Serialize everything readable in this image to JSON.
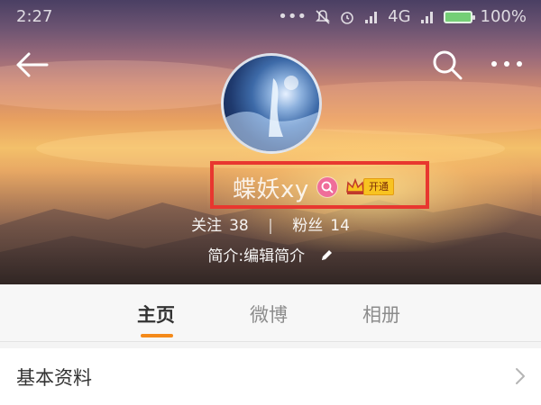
{
  "status_bar": {
    "time": "2:27",
    "network": "4G",
    "battery": "100%"
  },
  "profile": {
    "name": "蝶妖xy",
    "vip_open_label": "开通",
    "following_label": "关注",
    "following_count": "38",
    "followers_label": "粉丝",
    "followers_count": "14",
    "bio": "简介:编辑简介"
  },
  "tabs": [
    {
      "label": "主页",
      "active": true
    },
    {
      "label": "微博",
      "active": false
    },
    {
      "label": "相册",
      "active": false
    }
  ],
  "info_row": {
    "label": "基本资料"
  },
  "colors": {
    "highlight_box": "#e8372f",
    "tab_indicator": "#f48a1a",
    "vip_badge": "#f8c321",
    "search_badge": "#ef6d9a"
  },
  "icons": [
    "back-arrow-icon",
    "search-icon",
    "more-icon",
    "pencil-icon",
    "chevron-right-icon",
    "crown-icon",
    "mute-icon",
    "alarm-icon",
    "signal-icon",
    "battery-icon"
  ]
}
